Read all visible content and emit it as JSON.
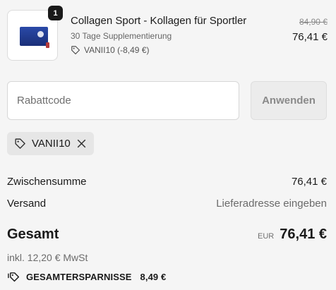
{
  "product": {
    "quantity": "1",
    "title": "Collagen Sport - Kollagen für Sportler",
    "subtitle": "30 Tage Supplementierung",
    "discount_label": "VANII10 (-8,49 €)",
    "original_price": "84,90 €",
    "price": "76,41 €"
  },
  "discount_form": {
    "placeholder": "Rabattcode",
    "value": "",
    "apply_label": "Anwenden"
  },
  "applied_code": {
    "code": "VANII10"
  },
  "summary": {
    "subtotal_label": "Zwischensumme",
    "subtotal_value": "76,41 €",
    "shipping_label": "Versand",
    "shipping_value": "Lieferadresse eingeben",
    "total_label": "Gesamt",
    "currency": "EUR",
    "total_value": "76,41 €",
    "tax_note": "inkl. 12,20 € MwSt",
    "savings_label": "GESAMTERSPARNISSE",
    "savings_value": "8,49 €"
  },
  "icons": {
    "tag": "tag-icon",
    "close": "close-icon",
    "savings": "savings-tag-icon"
  },
  "colors": {
    "background": "#f5f5f5",
    "text": "#1a1a1a",
    "muted": "#6b6b6b",
    "badge": "#1a1a1a",
    "chip": "#e6e6e6",
    "button_disabled": "#ececec"
  }
}
